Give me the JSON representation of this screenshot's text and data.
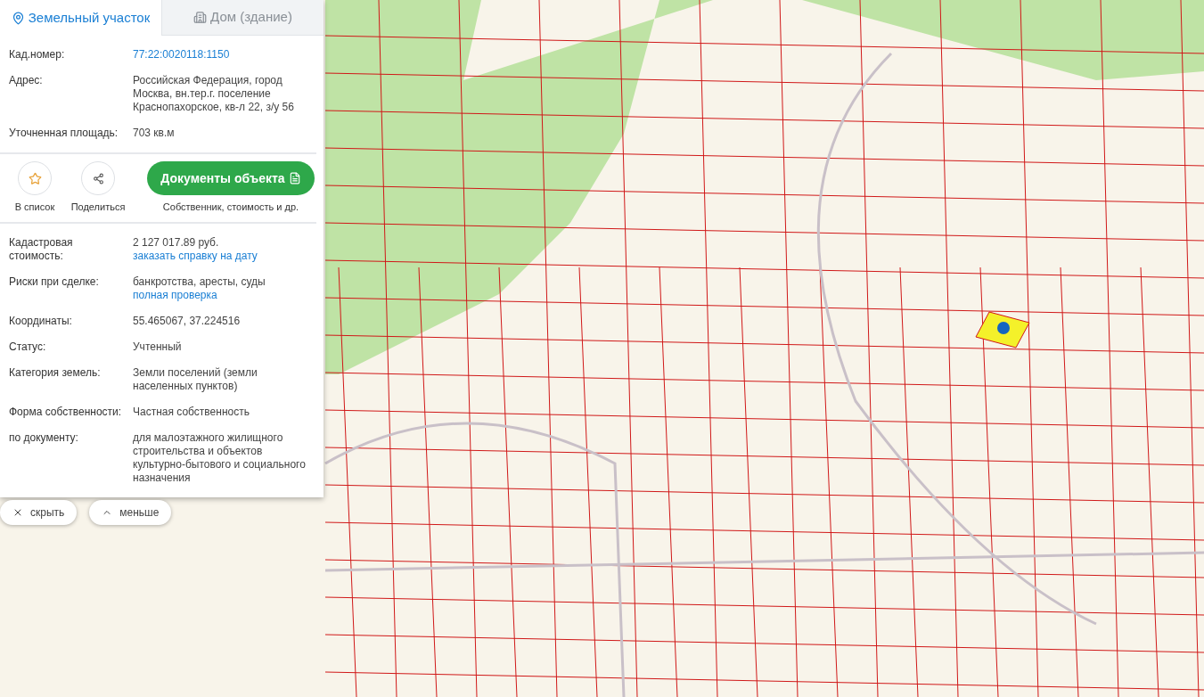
{
  "tabs": [
    {
      "label": "Земельный участок",
      "selected": true,
      "kind": "pin"
    },
    {
      "label": "Дом (здание)",
      "selected": false,
      "kind": "building"
    }
  ],
  "info_top": [
    {
      "label": "Кад.номер:",
      "parts": [
        {
          "kind": "link",
          "text": "77:22:0020118:1150"
        }
      ]
    },
    {
      "label": "Адрес:",
      "parts": [
        {
          "kind": "text",
          "text": "Российская Федерация, город Москва, вн.тер.г. поселение Краснопахорское, кв-л 22, з/у 56"
        }
      ]
    },
    {
      "label": "Уточненная площадь:",
      "parts": [
        {
          "kind": "text",
          "text": "703 кв.м"
        }
      ]
    }
  ],
  "actions": {
    "favorite": "В список",
    "share": "Поделиться",
    "documents_button": "Документы объекта",
    "documents_note": "Собственник, стоимость и др."
  },
  "info_bottom": [
    {
      "label": "Кадастровая стоимость:",
      "parts": [
        {
          "kind": "text",
          "text": "2 127 017.89 руб."
        },
        {
          "kind": "link",
          "text": "заказать справку на дату"
        }
      ]
    },
    {
      "label": "Риски при сделке:",
      "parts": [
        {
          "kind": "text",
          "text": "банкротства, аресты, суды"
        },
        {
          "kind": "link",
          "text": "полная проверка"
        }
      ]
    },
    {
      "label": "Координаты:",
      "parts": [
        {
          "kind": "text",
          "text": "55.465067, 37.224516"
        }
      ]
    },
    {
      "label": "Статус:",
      "parts": [
        {
          "kind": "text",
          "text": "Учтенный"
        }
      ]
    },
    {
      "label": "Категория земель:",
      "parts": [
        {
          "kind": "text",
          "text": "Земли поселений (земли населенных пунктов)"
        }
      ]
    },
    {
      "label": "Форма собственности:",
      "parts": [
        {
          "kind": "text",
          "text": "Частная собственность"
        }
      ]
    },
    {
      "label": "по документу:",
      "parts": [
        {
          "kind": "text",
          "text": "для малоэтажного жилищного строительства и объектов культурно-бытового и социального назначения"
        }
      ]
    }
  ],
  "panel_controls": [
    {
      "label": "скрыть",
      "kind": "close"
    },
    {
      "label": "меньше",
      "kind": "chevron-up"
    }
  ]
}
